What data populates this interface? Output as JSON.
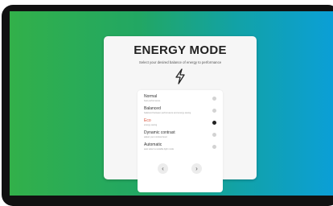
{
  "dialog": {
    "title": "ENERGY MODE",
    "subtitle": "Select your desired balance of energy to performance",
    "icon": "lightning-bolt-icon"
  },
  "options": [
    {
      "label": "Normal",
      "desc": "best performance",
      "selected": false
    },
    {
      "label": "Balanced",
      "desc": "balanced between performance and energy saving",
      "selected": false
    },
    {
      "label": "Eco",
      "desc": "energy saving",
      "selected": true
    },
    {
      "label": "Dynamic contrast",
      "desc": "adjust your contrast level",
      "selected": false
    },
    {
      "label": "Automatic",
      "desc": "auto select a suitable light mode",
      "selected": false
    }
  ],
  "nav": {
    "prev_icon": "chevron-left-icon",
    "next_icon": "chevron-right-icon"
  },
  "colors": {
    "accent": "#d9533a",
    "background_left": "#32b04a",
    "background_right": "#0b9fd6"
  }
}
